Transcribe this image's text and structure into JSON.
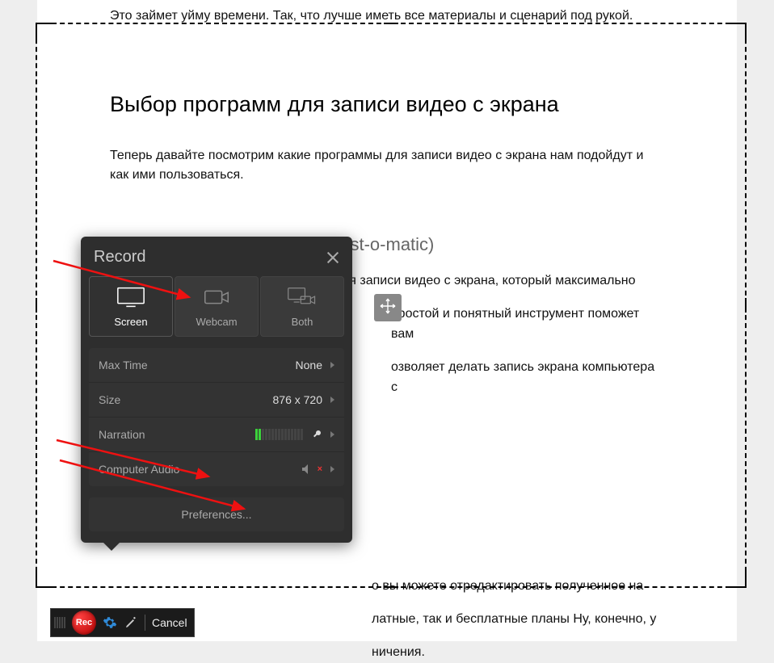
{
  "article": {
    "intro": "Это займет уйму времени. Так, что лучше иметь все материалы и сценарий под рукой.",
    "heading": "Выбор программ для записи видео с экрана",
    "para1": "Теперь давайте посмотрим какие программы для записи видео с экрана нам подойдут и как ими пользоваться.",
    "subhead": "Скринкаст-о-метик (Screencast-o-matic)",
    "para2a": "Screencast-O-Matic – это инструмент для записи видео с экрана, который максимально",
    "para2b": "простой и понятный инструмент поможет вам",
    "para2c": "озволяет делать запись экрана компьютера с",
    "para3a": "о вы можете отредактировать полученное на",
    "para3b": "латные, так и бесплатные планы Ну, конечно, у",
    "para3c": "ничения."
  },
  "panel": {
    "title": "Record",
    "tabs": {
      "screen": "Screen",
      "webcam": "Webcam",
      "both": "Both"
    },
    "rows": {
      "maxtime_k": "Max Time",
      "maxtime_v": "None",
      "size_k": "Size",
      "size_v": "876 x 720",
      "narration_k": "Narration",
      "audio_k": "Computer Audio"
    },
    "preferences": "Preferences..."
  },
  "toolbar": {
    "rec": "Rec",
    "cancel": "Cancel"
  }
}
